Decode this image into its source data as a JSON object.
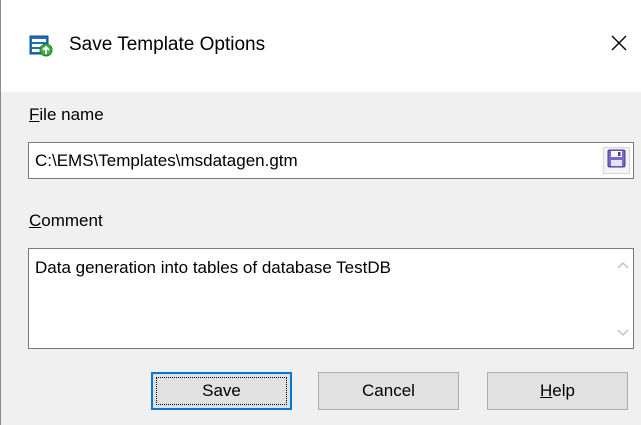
{
  "window": {
    "title": "Save Template Options",
    "icon": "save-template-app-icon",
    "close_icon": "close-icon"
  },
  "file_name": {
    "label_accel": "F",
    "label_rest": "ile name",
    "value": "C:\\EMS\\Templates\\msdatagen.gtm",
    "button_icon": "floppy-disk-icon"
  },
  "comment": {
    "label_accel": "C",
    "label_rest": "omment",
    "value": "Data generation into tables of database TestDB",
    "scroll_up_icon": "chevron-up-icon",
    "scroll_down_icon": "chevron-down-icon"
  },
  "buttons": {
    "save": "Save",
    "cancel": "Cancel",
    "help_accel": "H",
    "help_rest": "elp"
  },
  "colors": {
    "accent": "#0078d7",
    "floppy": "#6a5acd"
  }
}
